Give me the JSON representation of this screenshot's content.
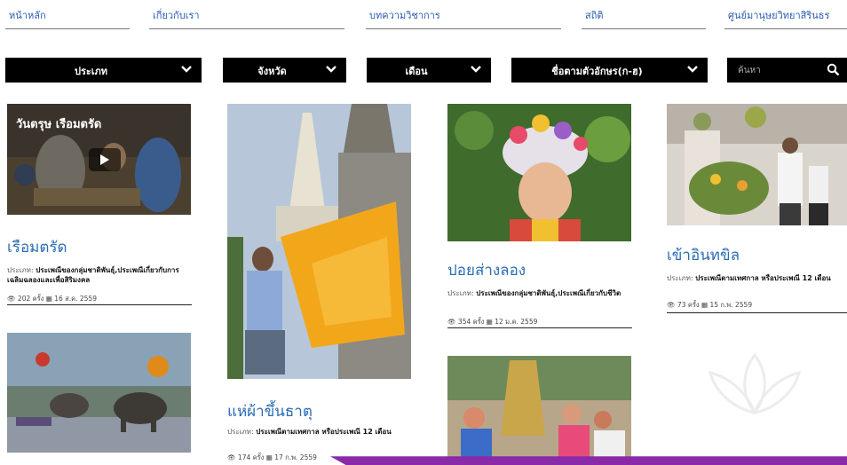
{
  "nav": {
    "home": "หน้าหลัก",
    "about": "เกี่ยวกับเรา",
    "articles": "บทความวิชาการ",
    "stats": "สถิติ",
    "center": "ศูนย์มานุษยวิทยาสิรินธร"
  },
  "filters": {
    "type": "ประเภท",
    "province": "จังหวัด",
    "month": "เดือน",
    "alpha": "ชื่อตามตัวอักษร(ก-ฮ)",
    "search_placeholder": "ค้นหา"
  },
  "cards": [
    {
      "title": "เรือมตรัด",
      "video_title": "วันตรุษ เรือมตรัด",
      "meta_label": "ประเภท:",
      "meta_value": "ประเพณีของกลุ่มชาติพันธุ์,ประเพณีเกี่ยวกับการเฉลิมฉลองและเพื่อสิริมงคล",
      "views": "202",
      "views_unit": "ครั้ง",
      "date": "16 ส.ค. 2559"
    },
    {
      "title": "แห่ผ้าขึ้นธาตุ",
      "meta_label": "ประเภท:",
      "meta_value": "ประเพณีตามเทศกาล หรือประเพณี 12 เดือน",
      "views": "174",
      "views_unit": "ครั้ง",
      "date": "17 ก.พ. 2559"
    },
    {
      "title": "ปอยส่างลอง",
      "meta_label": "ประเภท:",
      "meta_value": "ประเพณีของกลุ่มชาติพันธุ์,ประเพณีเกี่ยวกับชีวิต",
      "views": "354",
      "views_unit": "ครั้ง",
      "date": "12 ม.ค. 2559"
    },
    {
      "title": "เข้าอินทขิล",
      "meta_label": "ประเภท:",
      "meta_value": "ประเพณีตามเทศกาล หรือประเพณี 12 เดือน",
      "views": "73",
      "views_unit": "ครั้ง",
      "date": "15 ก.พ. 2559"
    }
  ],
  "icons": {
    "chevron": "chevron-down-icon",
    "search": "search-icon",
    "eye": "eye-icon",
    "calendar": "calendar-icon",
    "play": "play-icon"
  },
  "colors": {
    "link_blue": "#2a6cb4",
    "filter_bg": "#000000",
    "accent_purple": "#8a2aa8"
  }
}
